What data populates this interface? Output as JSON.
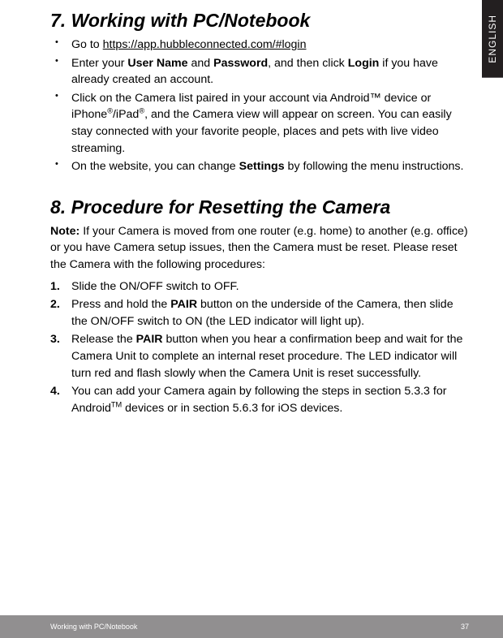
{
  "lang_tab": "ENGLISH",
  "section7": {
    "heading": "7. Working with PC/Notebook",
    "b1_pre": "Go to ",
    "b1_link": "https://app.hubbleconnected.com/#login",
    "b2_a": "Enter your ",
    "b2_b": "User Name",
    "b2_c": " and ",
    "b2_d": "Password",
    "b2_e": ", and then click ",
    "b2_f": "Login",
    "b2_g": " if you have already created an account.",
    "b3_a": "Click on the Camera list paired in your account via Android™ device or iPhone",
    "b3_b": "/iPad",
    "b3_c": ", and the Camera view will appear on screen. You can easily stay connected with your favorite people, places and pets with live video streaming.",
    "b4_a": "On the website, you can change ",
    "b4_b": "Settings",
    "b4_c": " by following the menu instructions."
  },
  "section8": {
    "heading": "8. Procedure for Resetting the Camera",
    "note_label": "Note:",
    "note_body": " If your Camera is moved from one router (e.g. home) to another (e.g. office) or you have Camera setup issues, then the Camera must be reset. Please reset the Camera with the following procedures:",
    "s1": "Slide the ON/OFF switch to OFF.",
    "s2_a": "Press and hold the ",
    "s2_b": "PAIR",
    "s2_c": " button on the underside of the Camera, then slide the ON/OFF switch to ON (the LED indicator will light up).",
    "s3_a": "Release the ",
    "s3_b": "PAIR",
    "s3_c": " button when you hear a confirmation beep and wait for the Camera Unit to complete an internal reset procedure. The LED indicator will turn red and flash slowly when the Camera Unit is reset successfully.",
    "s4_a": "You can add your Camera again by following the steps in section 5.3.3 for Android",
    "s4_b": " devices or in section 5.6.3 for iOS devices."
  },
  "footer": {
    "left": "Working with PC/Notebook",
    "right": "37"
  }
}
